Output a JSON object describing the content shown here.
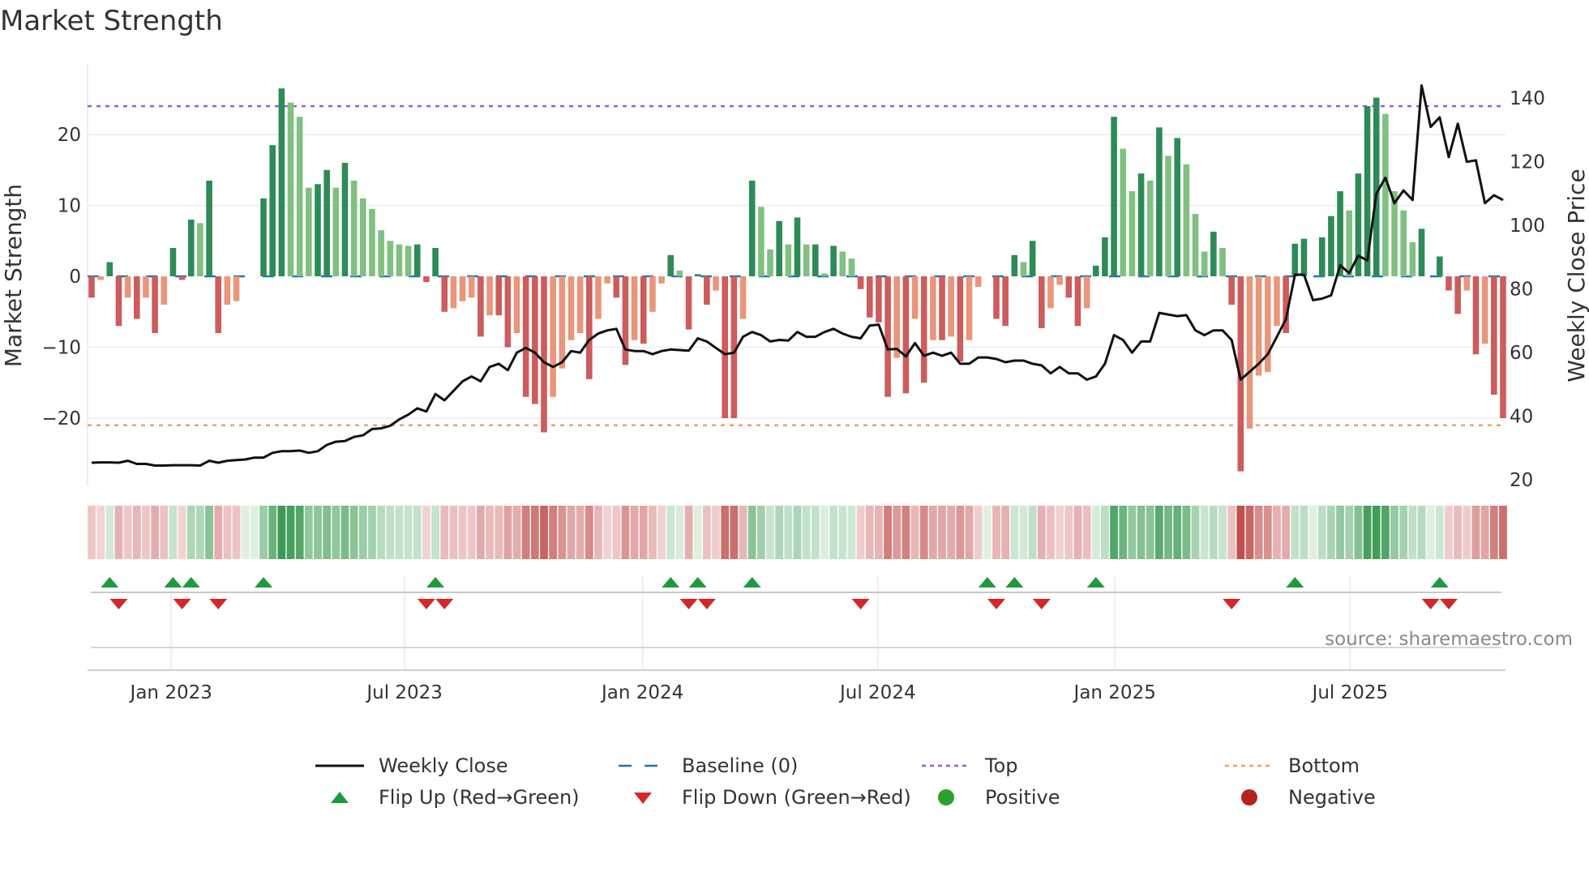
{
  "title": "Market Strength",
  "source": "source: sharemaestro.com",
  "chart_data": {
    "type": "bar",
    "title": "Market Strength",
    "ylabel": "Market Strength",
    "y2label": "Weekly Close Price",
    "ylim": [
      -29.6,
      29.6
    ],
    "y2lim": [
      18,
      150
    ],
    "yticks": [
      -20,
      -10,
      0,
      10,
      20
    ],
    "ytick_labels": [
      "−20",
      "−10",
      "0",
      "10",
      "20"
    ],
    "y2ticks": [
      20,
      40,
      60,
      80,
      100,
      120,
      140
    ],
    "y2tick_labels": [
      "20",
      "40",
      "60",
      "80",
      "100",
      "120",
      "140"
    ],
    "xtick_labels": [
      "Jan 2023",
      "Jul 2023",
      "Jan 2024",
      "Jul 2024",
      "Jan 2025",
      "Jul 2025"
    ],
    "xtick_week_index": [
      8.8,
      34.6,
      60.9,
      86.9,
      113.1,
      139.1
    ],
    "top_level": 24,
    "bottom_level": -21,
    "baseline": 0,
    "grid": true,
    "legend_position": "bottom",
    "strength": [
      -3,
      -0.5,
      2,
      -7,
      -3,
      -6,
      -3,
      -8,
      -4,
      4,
      -0.5,
      8,
      7.5,
      13.5,
      -8,
      -4,
      -3.5,
      0,
      0,
      11,
      18.5,
      26.5,
      24.5,
      22.5,
      12.5,
      13,
      15,
      12.5,
      16,
      13.5,
      11,
      9.5,
      6.5,
      5,
      4.5,
      4.3,
      4.5,
      -0.8,
      4,
      -5,
      -4.5,
      -3.5,
      -3,
      -8.5,
      -5.5,
      -5.5,
      -10,
      -8,
      -17,
      -18,
      -22,
      -17,
      -13,
      -9,
      -8,
      -14.5,
      -6,
      -1,
      -3,
      -12.5,
      -9,
      -9.5,
      -5,
      -1,
      3,
      0.8,
      -7.5,
      0.3,
      -4,
      -2,
      -20,
      -20,
      -6,
      13.5,
      9.8,
      3.8,
      7.8,
      4.5,
      8.3,
      4.5,
      4.5,
      0.4,
      4.3,
      3.5,
      2.5,
      -1.8,
      -5.8,
      -6.5,
      -17,
      -11.5,
      -16.5,
      -6,
      -15,
      -9,
      -9,
      -8.5,
      -12,
      -9,
      -1.5,
      0,
      -6,
      -7,
      3,
      2,
      5,
      -7.3,
      -4.5,
      -1.2,
      -3,
      -7,
      -4.5,
      1.5,
      5.5,
      22.5,
      18,
      12,
      14.5,
      13.5,
      21,
      17,
      19.5,
      15.8,
      8.8,
      3.5,
      6.3,
      4,
      -4,
      -27.5,
      -21.5,
      -14,
      -13.5,
      -7,
      -8,
      4.6,
      5.3,
      0,
      5.5,
      8.5,
      12,
      9.3,
      14.5,
      24,
      25.2,
      22.9,
      12,
      9.3,
      4.8,
      6.7,
      0,
      2.8,
      -2,
      -5.3,
      -2,
      -11,
      -9.5,
      -16.7,
      -20
    ],
    "weekly_close": [
      25.4,
      25.5,
      25.5,
      25.4,
      26,
      25,
      25,
      24.5,
      24.5,
      24.6,
      24.6,
      24.6,
      24.5,
      26,
      25.4,
      26,
      26.2,
      26.4,
      27,
      27,
      28.5,
      29,
      29,
      29.2,
      28.5,
      29,
      31,
      32,
      32.2,
      33.5,
      34,
      36,
      36.2,
      37,
      39,
      40.5,
      42.5,
      41.5,
      47,
      45,
      48,
      51,
      52.5,
      51,
      55.5,
      56.5,
      54.5,
      60,
      61.5,
      60,
      57,
      55.5,
      57,
      60.5,
      60,
      64,
      66,
      67,
      67.5,
      61,
      60.5,
      60.5,
      59.5,
      60.5,
      61,
      60.8,
      60.6,
      64.5,
      63.5,
      61.5,
      59.5,
      60,
      65,
      66.5,
      65.5,
      63.5,
      64,
      63.8,
      66.5,
      65,
      65,
      66.5,
      67.5,
      66,
      65,
      64.5,
      68.5,
      68.8,
      61,
      61.2,
      58.8,
      63,
      59,
      60,
      59,
      60,
      56.5,
      56.5,
      58.5,
      58.5,
      58,
      57,
      57.5,
      57.5,
      56.5,
      56,
      53.5,
      55.5,
      53.5,
      53.5,
      51.5,
      52.5,
      56.5,
      65.5,
      64,
      60,
      63.5,
      63.5,
      72.5,
      72,
      71.5,
      71.8,
      67,
      65.5,
      67,
      67,
      64,
      51.5,
      54,
      56.5,
      59.5,
      65,
      70.5,
      84.5,
      84.5,
      76.5,
      77,
      78,
      87.5,
      85,
      90.5,
      89,
      110,
      115,
      107,
      111,
      108,
      144,
      131,
      134,
      121.5,
      132,
      120,
      120.5,
      107,
      109.5,
      108
    ],
    "flip_up_weeks": [
      2,
      9,
      11,
      19,
      38,
      64,
      67,
      73,
      99,
      102,
      111,
      133,
      149
    ],
    "flip_down_weeks": [
      3,
      10,
      14,
      37,
      39,
      66,
      68,
      85,
      100,
      105,
      126,
      148,
      150
    ],
    "colors": {
      "pos_rising": "#2e8b57",
      "pos_falling": "#80c080",
      "neg_falling": "#cd5c5c",
      "neg_rising": "#e9967a",
      "close": "#111111",
      "baseline": "#1f77b4",
      "top": "#9b59d6",
      "bottom": "#f0a060",
      "flip_up": "#1e9a3c",
      "flip_down": "#d62728",
      "positive": "#2ca02c",
      "negative": "#b22222"
    }
  },
  "legend": [
    {
      "label": "Weekly Close",
      "symbol": "line"
    },
    {
      "label": "Baseline (0)",
      "symbol": "dash"
    },
    {
      "label": "Top",
      "symbol": "dot-purple"
    },
    {
      "label": "Bottom",
      "symbol": "dot-orange"
    },
    {
      "label": "Flip Up (Red→Green)",
      "symbol": "tri-up"
    },
    {
      "label": "Flip Down (Green→Red)",
      "symbol": "tri-down"
    },
    {
      "label": "Positive",
      "symbol": "circle-green"
    },
    {
      "label": "Negative",
      "symbol": "circle-red"
    }
  ]
}
